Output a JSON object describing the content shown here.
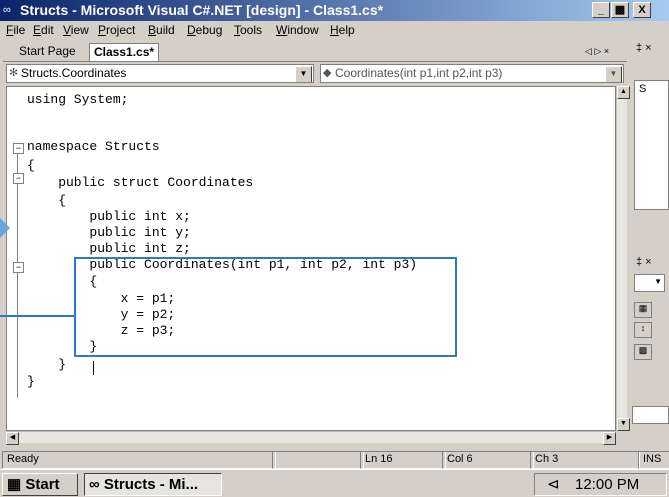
{
  "window": {
    "title": "Structs - Microsoft Visual C#.NET [design] - Class1.cs*",
    "buttons": [
      "_",
      "»",
      "X"
    ]
  },
  "menu": [
    "File",
    "Edit",
    "View",
    "Project",
    "Build",
    "Debug",
    "Tools",
    "Window",
    "Help"
  ],
  "tabs": {
    "start_page": "Start Page",
    "active": "Class1.cs*",
    "nav": "◁ ▷ ×"
  },
  "dropdowns": {
    "class": "Structs.Coordinates",
    "member": "Coordinates(int p1,int p2,int p3)"
  },
  "code_lines": [
    "using System;",
    "",
    "namespace Structs",
    "{",
    "    public struct Coordinates",
    "    {",
    "        public int x;",
    "        public int y;",
    "        public int z;",
    "        public Coordinates(int p1, int p2, int p3)",
    "        {",
    "            x = p1;",
    "            y = p2;",
    "            z = p3;",
    "        }",
    "    }",
    "}"
  ],
  "status": {
    "text": "Ready",
    "ln": "Ln 16",
    "col": "Col 6",
    "ch": "Ch 3",
    "mode": "INS"
  },
  "taskbar": {
    "start": "Start",
    "task": "Structs - Mi...",
    "clock": "12:00 PM"
  },
  "right_pane": {
    "pin": "‡ ×",
    "pin2": "‡ ×",
    "tree_label": "S"
  },
  "colors": {
    "highlight": "#2a7bc4",
    "titlebar_start": "#0a246a",
    "titlebar_end": "#a6caf0"
  }
}
